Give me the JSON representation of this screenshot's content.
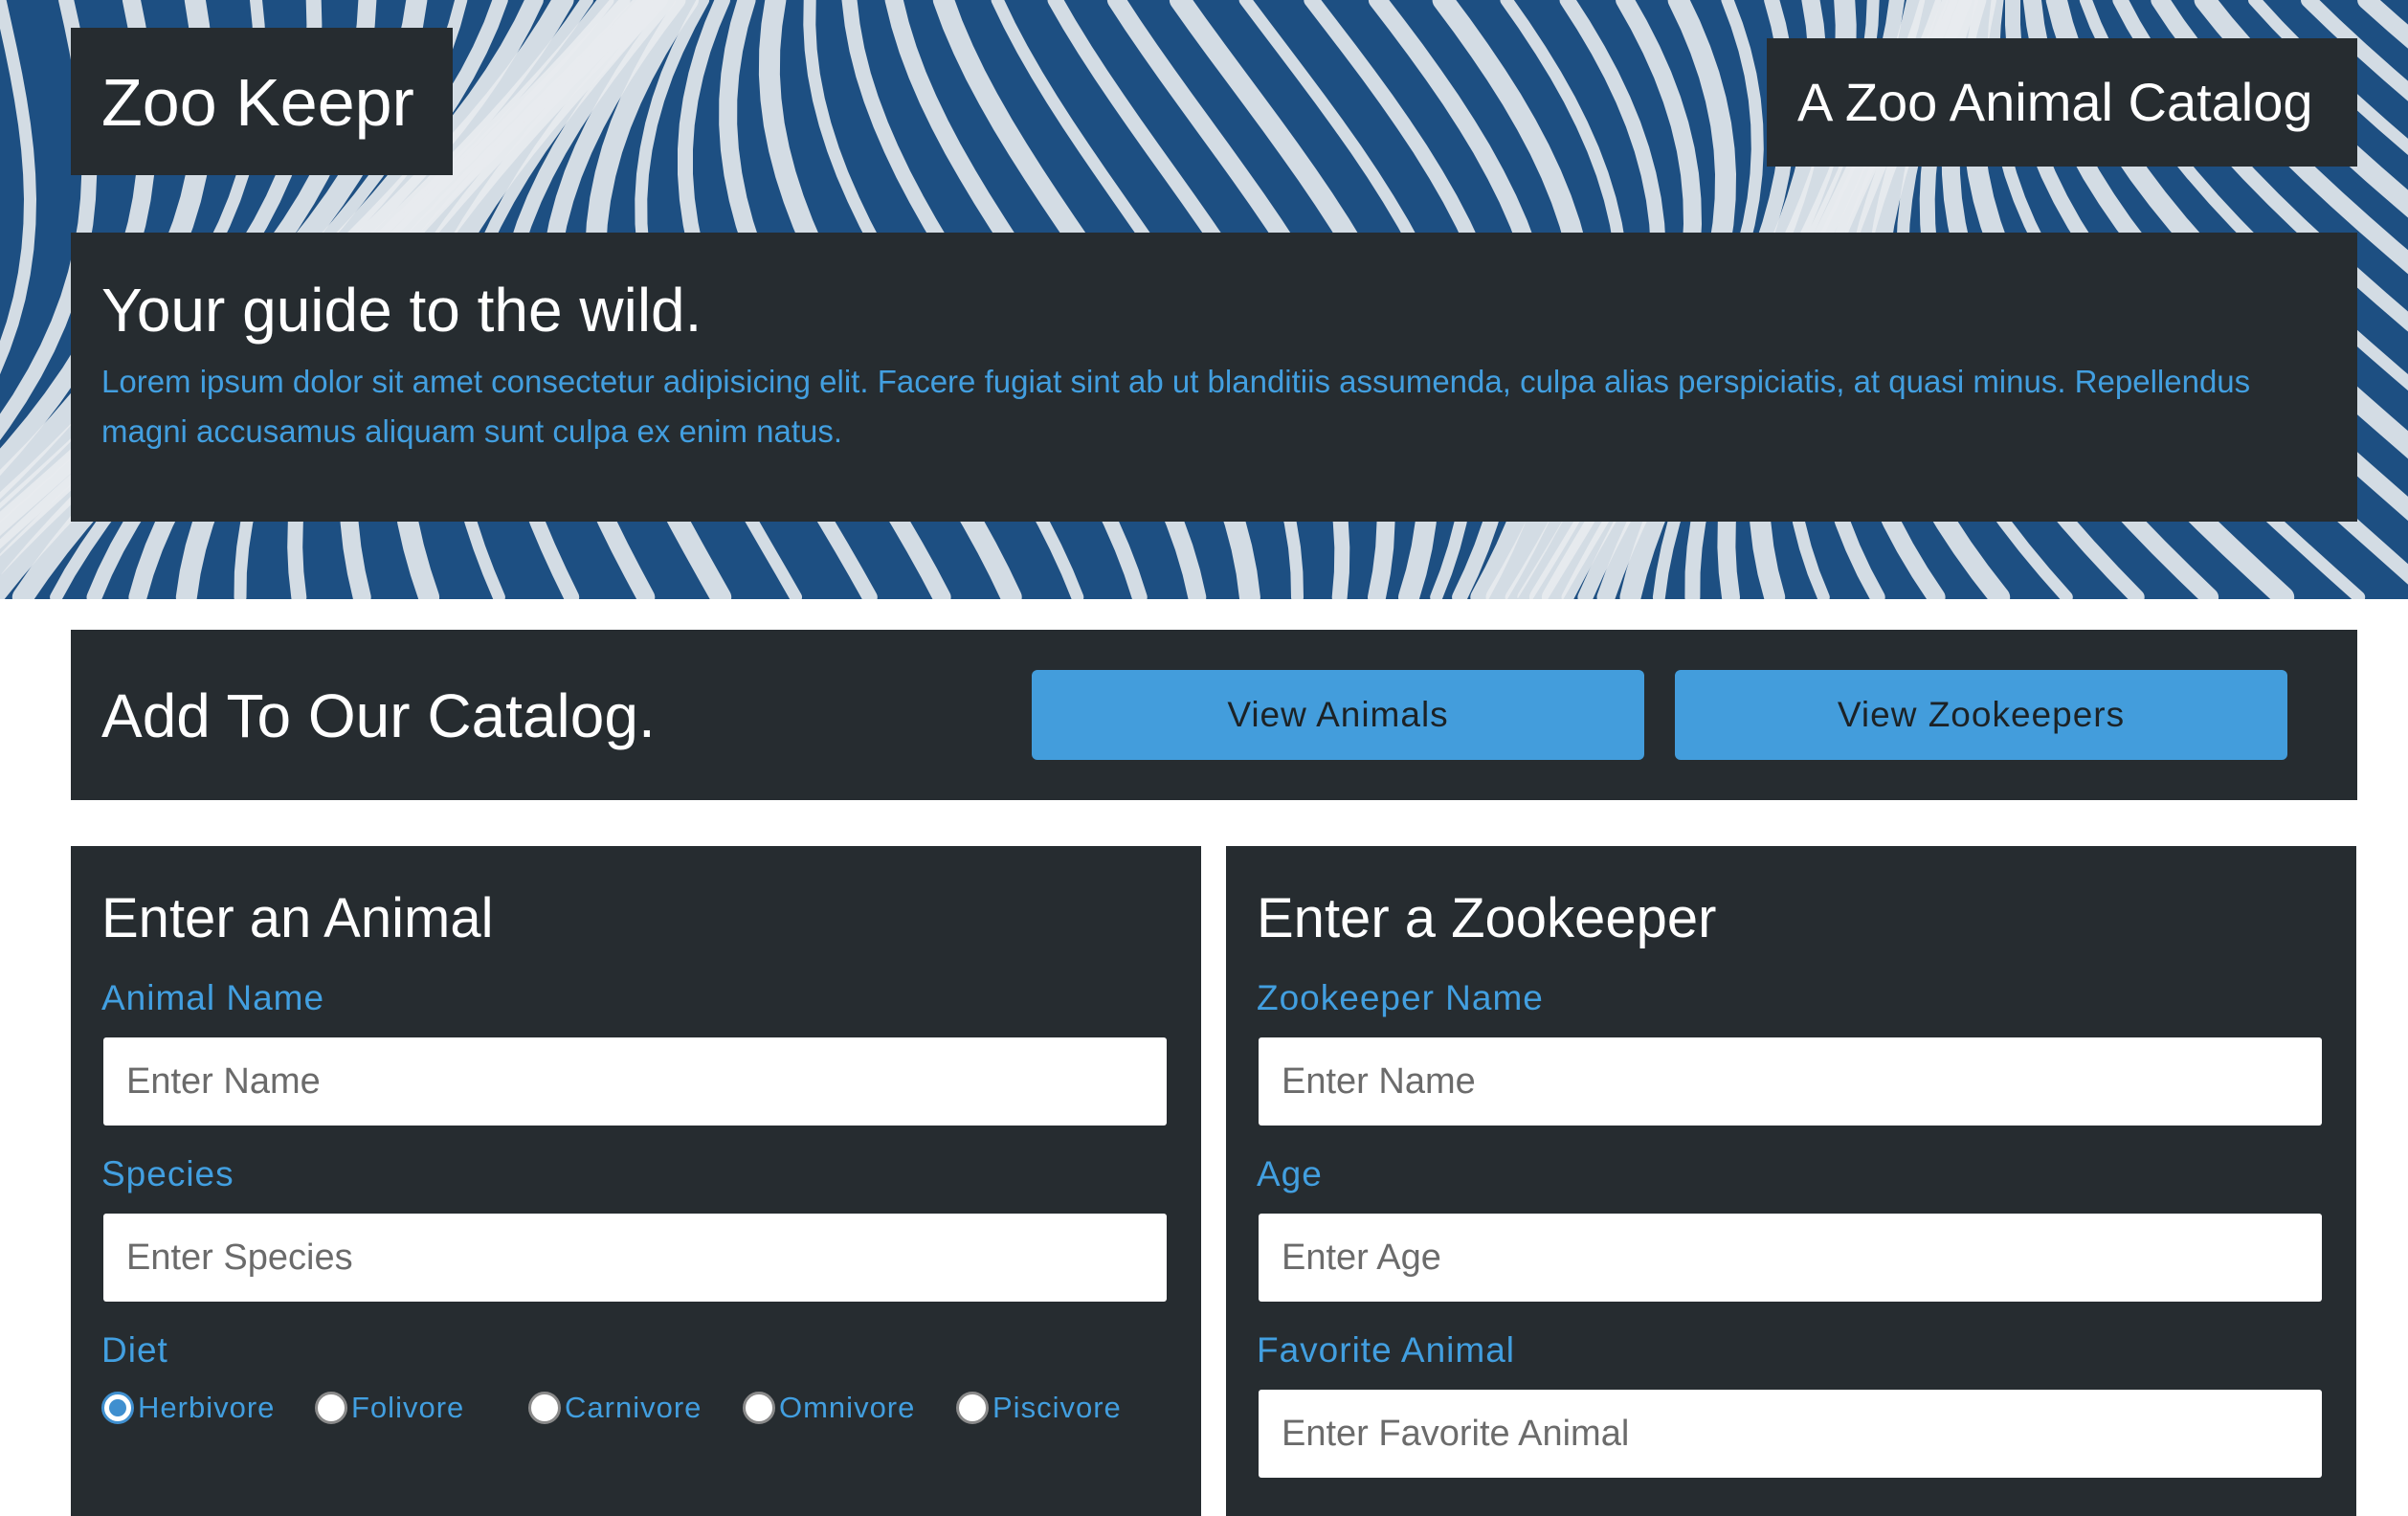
{
  "header": {
    "brand": "Zoo Keepr",
    "tagline": "A Zoo Animal Catalog"
  },
  "intro": {
    "heading": "Your guide to the wild.",
    "body": "Lorem ipsum dolor sit amet consectetur adipisicing elit. Facere fugiat sint ab ut blanditiis assumenda, culpa alias perspiciatis, at quasi minus. Repellendus magni accusamus aliquam sunt culpa ex enim natus."
  },
  "catalog": {
    "heading": "Add To Our Catalog.",
    "view_animals": "View Animals",
    "view_zookeepers": "View Zookeepers"
  },
  "animal_form": {
    "heading": "Enter an Animal",
    "name_label": "Animal Name",
    "name_placeholder": "Enter Name",
    "species_label": "Species",
    "species_placeholder": "Enter Species",
    "diet_label": "Diet",
    "diet_options": [
      "Herbivore",
      "Folivore",
      "Carnivore",
      "Omnivore",
      "Piscivore"
    ],
    "diet_selected": "Herbivore"
  },
  "zookeeper_form": {
    "heading": "Enter a Zookeeper",
    "name_label": "Zookeeper Name",
    "name_placeholder": "Enter Name",
    "age_label": "Age",
    "age_placeholder": "Enter Age",
    "favorite_label": "Favorite Animal",
    "favorite_placeholder": "Enter Favorite Animal"
  },
  "colors": {
    "panel": "#262c30",
    "accent": "#429fe0",
    "button": "#439ddc",
    "hero_blue": "#1d4f82",
    "stripe": "#e8ebee"
  }
}
